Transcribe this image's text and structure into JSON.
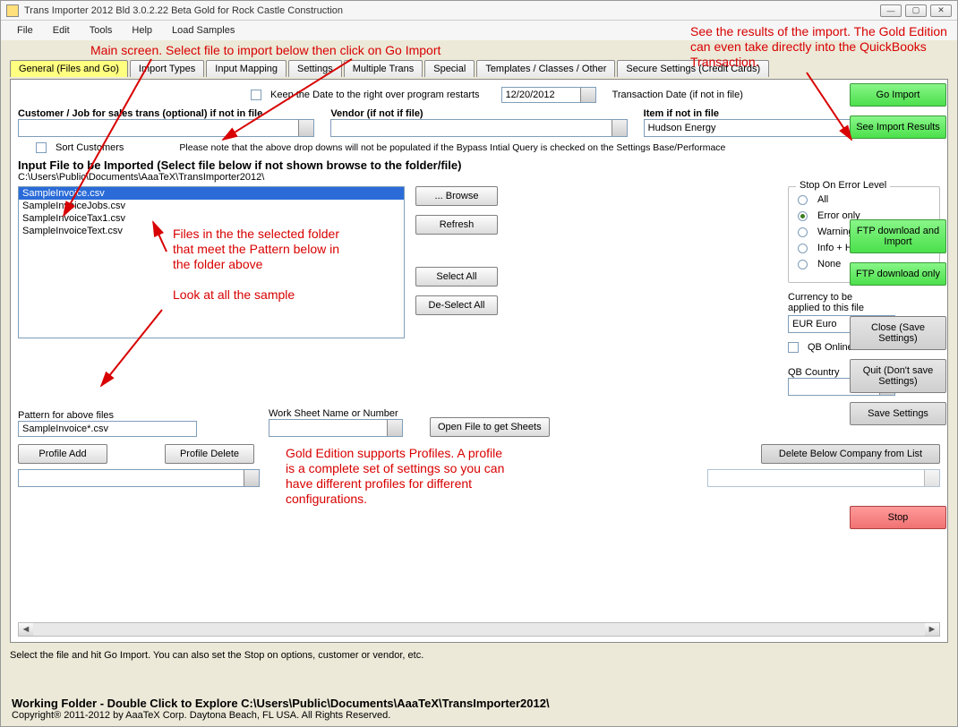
{
  "window": {
    "title": "Trans Importer 2012 Bld 3.0.2.22 Beta Gold  for Rock Castle Construction"
  },
  "menu": {
    "file": "File",
    "edit": "Edit",
    "tools": "Tools",
    "help": "Help",
    "loadSamples": "Load Samples"
  },
  "tabs": [
    "General (Files and Go)",
    "Import Types",
    "Input Mapping",
    "Settings",
    "Multiple Trans",
    "Special",
    "Templates / Classes / Other",
    "Secure Settings (Credit Cards)"
  ],
  "topControls": {
    "keepDateLabel": "Keep the Date to the right over program restarts",
    "dateValue": "12/20/2012",
    "transDateLabel": "Transaction Date (if not in file)"
  },
  "dropDowns": {
    "customerLabel": "Customer / Job for sales trans (optional) if not in file",
    "customerValue": "",
    "vendorLabel": "Vendor (if not if file)",
    "vendorValue": "",
    "itemLabel": "Item if not in file",
    "itemValue": "Hudson Energy"
  },
  "sortCustomers": "Sort Customers",
  "noteLine": "Please note that the above drop downs will not be populated if the Bypass Intial Query is checked on the Settings Base/Performace",
  "inputHeading": "Input File to be Imported (Select file below if not shown browse to the folder/file)",
  "inputPath": "C:\\Users\\Public\\Documents\\AaaTeX\\TransImporter2012\\",
  "files": [
    "SampleInvoice.csv",
    "SampleInvoiceJobs.csv",
    "SampleInvoiceTax1.csv",
    "SampleInvoiceText.csv"
  ],
  "fileButtons": {
    "browse": "... Browse",
    "refresh": "Refresh",
    "selectAll": "Select All",
    "deselectAll": "De-Select All"
  },
  "stopOnError": {
    "title": "Stop On Error Level",
    "options": [
      "All",
      "Error only",
      "Warning +",
      "Info + Higher",
      "None"
    ],
    "selected": "Error only"
  },
  "currency": {
    "label1": "Currency to be",
    "label2": "applied to this file",
    "value": "EUR Euro"
  },
  "qbOnline": "QB Online Edition",
  "qbCountry": {
    "label": "QB Country",
    "value": ""
  },
  "patternLabel": "Pattern for above files",
  "patternValue": "SampleInvoice*.csv",
  "worksheetLabel": "Work Sheet Name or Number",
  "openFileSheets": "Open File to get Sheets",
  "profileAdd": "Profile Add",
  "profileDelete": "Profile Delete",
  "deleteCompanyBtn": "Delete Below Company from List",
  "instructionLine": "Select the file and hit Go Import. You can also set the Stop on options, customer or vendor, etc.",
  "sideButtons": {
    "goImport": "Go Import",
    "seeResults": "See Import Results",
    "ftpImport": "FTP download and Import",
    "ftpOnly": "FTP download only",
    "closeSave": "Close (Save Settings)",
    "quitNoSave": "Quit (Don't save Settings)",
    "saveSettings": "Save Settings",
    "stop": "Stop"
  },
  "footer": {
    "workingFolder": "Working Folder - Double Click to Explore C:\\Users\\Public\\Documents\\AaaTeX\\TransImporter2012\\",
    "copyright": "Copyright® 2011-2012 by AaaTeX Corp. Daytona Beach, FL USA. All Rights Reserved."
  },
  "annotations": {
    "mainScreen": "Main screen.  Select file to import below then click on Go Import",
    "filesNote": "Files in the the selected folder that meet the Pattern below in the folder above\n\nLook at all the sample",
    "profilesNote": "Gold Edition supports Profiles. A profile is a complete set of settings so you can have different profiles for different configurations.",
    "resultsNote": "See the results of the import. The Gold Edition can even take directly into the QuickBooks Transaction."
  }
}
